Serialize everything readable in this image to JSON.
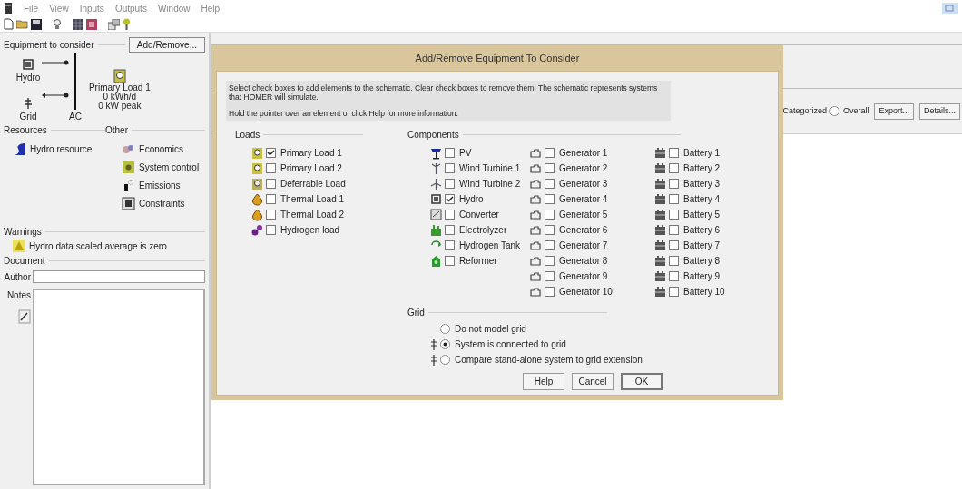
{
  "menu": [
    "File",
    "View",
    "Inputs",
    "Outputs",
    "Window",
    "Help"
  ],
  "equipment": {
    "label": "Equipment to consider",
    "button": "Add/Remove...",
    "hydro": "Hydro",
    "grid": "Grid",
    "bus": "AC",
    "load": [
      "Primary Load 1",
      "0 kWh/d",
      "0 kW peak"
    ]
  },
  "resources": {
    "label": "Resources",
    "items": [
      "Hydro resource"
    ]
  },
  "other": {
    "label": "Other",
    "items": [
      "Economics",
      "System control",
      "Emissions",
      "Constraints"
    ]
  },
  "warnings": {
    "label": "Warnings",
    "items": [
      "Hydro data scaled average is zero"
    ]
  },
  "document": {
    "label": "Document",
    "author_label": "Author",
    "notes_label": "Notes"
  },
  "results": {
    "categorized": "Categorized",
    "overall": {
      "label": "Overall",
      "selected": false
    },
    "buttons": [
      "Export...",
      "Details..."
    ]
  },
  "dialog": {
    "title": "Add/Remove Equipment To Consider",
    "info": [
      "Select check boxes to add elements to the schematic. Clear check boxes to remove them. The schematic represents systems that HOMER will simulate.",
      "Hold the pointer over an element or click Help for more information."
    ],
    "loads_label": "Loads",
    "loads": [
      {
        "label": "Primary Load 1",
        "checked": true
      },
      {
        "label": "Primary Load 2",
        "checked": false
      },
      {
        "label": "Deferrable Load",
        "checked": false
      },
      {
        "label": "Thermal Load 1",
        "checked": false
      },
      {
        "label": "Thermal Load 2",
        "checked": false
      },
      {
        "label": "Hydrogen load",
        "checked": false
      }
    ],
    "components_label": "Components",
    "components": [
      {
        "label": "PV",
        "checked": false
      },
      {
        "label": "Wind Turbine 1",
        "checked": false
      },
      {
        "label": "Wind Turbine 2",
        "checked": false
      },
      {
        "label": "Hydro",
        "checked": true
      },
      {
        "label": "Converter",
        "checked": false
      },
      {
        "label": "Electrolyzer",
        "checked": false
      },
      {
        "label": "Hydrogen Tank",
        "checked": false
      },
      {
        "label": "Reformer",
        "checked": false
      }
    ],
    "generators": [
      {
        "label": "Generator 1",
        "checked": false
      },
      {
        "label": "Generator 2",
        "checked": false
      },
      {
        "label": "Generator 3",
        "checked": false
      },
      {
        "label": "Generator 4",
        "checked": false
      },
      {
        "label": "Generator 5",
        "checked": false
      },
      {
        "label": "Generator 6",
        "checked": false
      },
      {
        "label": "Generator 7",
        "checked": false
      },
      {
        "label": "Generator 8",
        "checked": false
      },
      {
        "label": "Generator 9",
        "checked": false
      },
      {
        "label": "Generator 10",
        "checked": false
      }
    ],
    "batteries": [
      {
        "label": "Battery 1",
        "checked": false
      },
      {
        "label": "Battery 2",
        "checked": false
      },
      {
        "label": "Battery 3",
        "checked": false
      },
      {
        "label": "Battery 4",
        "checked": false
      },
      {
        "label": "Battery 5",
        "checked": false
      },
      {
        "label": "Battery 6",
        "checked": false
      },
      {
        "label": "Battery 7",
        "checked": false
      },
      {
        "label": "Battery 8",
        "checked": false
      },
      {
        "label": "Battery 9",
        "checked": false
      },
      {
        "label": "Battery 10",
        "checked": false
      }
    ],
    "grid_label": "Grid",
    "grid_options": [
      {
        "label": "Do not model grid",
        "selected": false
      },
      {
        "label": "System is connected to grid",
        "selected": true
      },
      {
        "label": "Compare stand-alone system to grid extension",
        "selected": false
      }
    ],
    "buttons": [
      "Help",
      "Cancel",
      "OK"
    ]
  }
}
